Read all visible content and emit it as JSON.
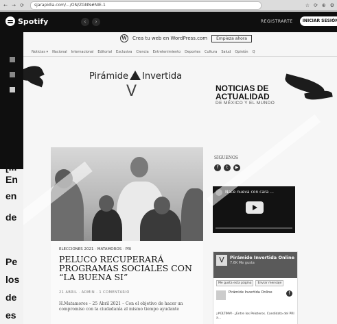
{
  "browser": {
    "url": "sjarapidia.com/.../ON/ZGNN#NIE-1",
    "nav": [
      "←",
      "→",
      "⟳"
    ],
    "icons": [
      "☆",
      "⟳",
      "⊕",
      "⚙"
    ]
  },
  "spotify": {
    "brand": "Spotify",
    "register": "REGISTRARTE",
    "login": "INICIAR SESIÓN"
  },
  "background_article": {
    "fragments": [
      {
        "text": "[..."
      },
      {
        "text": "En"
      },
      {
        "text": "go"
      },
      {
        "text": "en"
      },
      {
        "text": "de"
      },
      {
        "text": "de"
      },
      {
        "text": "Pe"
      },
      {
        "text": "ue"
      },
      {
        "text": "los"
      },
      {
        "text": "os"
      },
      {
        "text": "de"
      },
      {
        "text": "te"
      },
      {
        "text": "es"
      },
      {
        "text": "a"
      }
    ]
  },
  "wordpress": {
    "admin_text": "Crea tu web en WordPress.com",
    "signup": "Empieza ahora",
    "menu": [
      "Noticias ▾",
      "Nacional",
      "Internacional",
      "Editorial",
      "Exclusiva",
      "Ciencia",
      "Entretenimiento",
      "Deportes",
      "Cultura",
      "Salud",
      "Opinión",
      "Q"
    ],
    "site_title_left": "Pirámide",
    "site_title_right": "Invertida",
    "logo_v": "V",
    "tagline_main": "NOTICIAS DE\nACTUALIDAD",
    "tagline_sub": "DE MÉXICO Y EL MUNDO"
  },
  "article": {
    "breadcrumb": "ELECCIONES 2021 · MATAMOROS · PRI",
    "headline": "PELUCO RECUPERARÁ PROGRAMAS SOCIALES CON “LA BUENA SI”",
    "meta": "21 ABRIL · ADMIN · 1 COMENTARIO",
    "excerpt": "H.Matamoros – 25 Abril 2021 – Con el objetivo de hacer un compromiso con la ciudadanía al mismo tiempo ayudante"
  },
  "sidebar": {
    "follow_title": "SÍGUENOS",
    "social_icons": [
      "facebook-icon",
      "twitter-icon",
      "youtube-icon"
    ],
    "video_title": "Nace nueva con cara ...",
    "fb_name": "Pirámide Invertida Online",
    "fb_likes": "7.6K Me gusta",
    "fb_like_button": "Me gusta esta página",
    "fb_share_button": "Enviar mensaje",
    "fb_post_name": "Pirámide Invertida Online",
    "fb_footer": "¡#ÚLTIMA!-  ¿Entre los Peloteros. Candidato del PRI a..."
  }
}
